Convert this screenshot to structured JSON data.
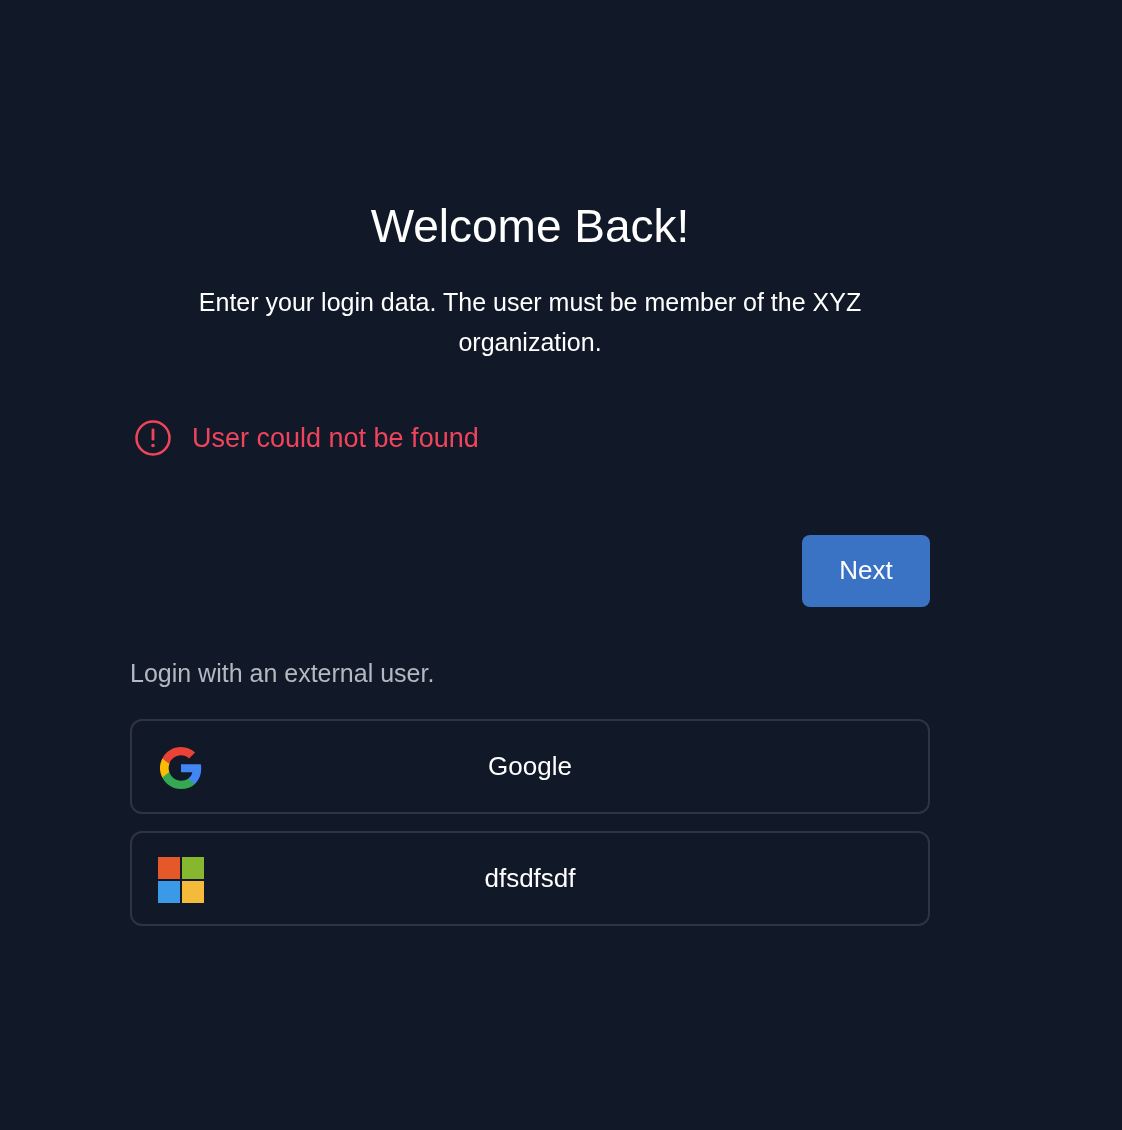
{
  "title": "Welcome Back!",
  "subtitle": "Enter your login data. The user must be member of the XYZ organization.",
  "error": {
    "message": "User could not be found"
  },
  "next_button": "Next",
  "external_label": "Login with an external user.",
  "providers": [
    {
      "kind": "google",
      "label": "Google"
    },
    {
      "kind": "microsoft",
      "label": "dfsdfsdf"
    }
  ]
}
